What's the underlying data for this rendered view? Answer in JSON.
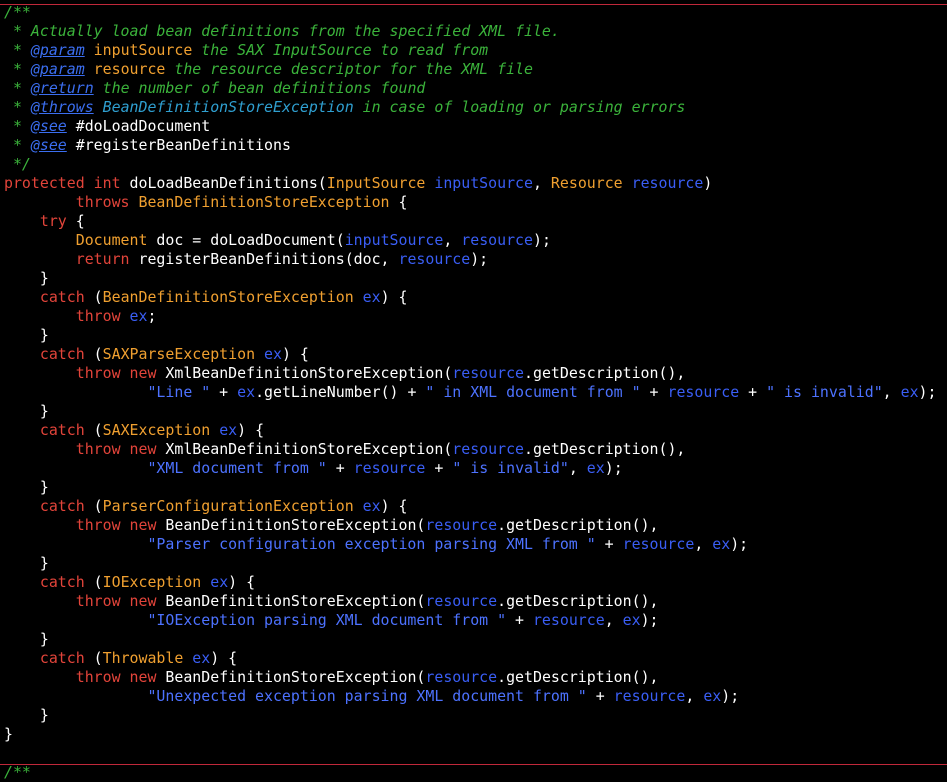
{
  "editor": {
    "language": "java",
    "colors": {
      "background": "#000000",
      "comment": "#3bb33b",
      "doc_tag": "#3b6ef0",
      "keyword": "#e2443a",
      "type": "#f0a030",
      "parameter": "#3a5ef5",
      "string": "#4d72ff",
      "plain": "#ffffff",
      "divider": "#c0283a"
    },
    "lines": [
      [
        {
          "c": "cm",
          "t": "/**"
        }
      ],
      [
        {
          "c": "cm",
          "t": " * Actually load bean definitions from the specified XML file."
        }
      ],
      [
        {
          "c": "cm",
          "t": " * "
        },
        {
          "c": "tag",
          "t": "@param"
        },
        {
          "c": "cm",
          "t": " "
        },
        {
          "c": "ty",
          "t": "inputSource"
        },
        {
          "c": "cm",
          "t": " the SAX InputSource to read from"
        }
      ],
      [
        {
          "c": "cm",
          "t": " * "
        },
        {
          "c": "tag",
          "t": "@param"
        },
        {
          "c": "cm",
          "t": " "
        },
        {
          "c": "ty",
          "t": "resource"
        },
        {
          "c": "cm",
          "t": " the resource descriptor for the XML file"
        }
      ],
      [
        {
          "c": "cm",
          "t": " * "
        },
        {
          "c": "tag",
          "t": "@return"
        },
        {
          "c": "cm",
          "t": " the number of bean definitions found"
        }
      ],
      [
        {
          "c": "cm",
          "t": " * "
        },
        {
          "c": "tag",
          "t": "@throws"
        },
        {
          "c": "cm",
          "t": " "
        },
        {
          "c": "tagx",
          "t": "BeanDefinitionStoreException"
        },
        {
          "c": "cm",
          "t": " in case of loading or parsing errors"
        }
      ],
      [
        {
          "c": "cm",
          "t": " * "
        },
        {
          "c": "tag",
          "t": "@see"
        },
        {
          "c": "cm",
          "t": " "
        },
        {
          "c": "pl",
          "t": "#doLoadDocument"
        }
      ],
      [
        {
          "c": "cm",
          "t": " * "
        },
        {
          "c": "tag",
          "t": "@see"
        },
        {
          "c": "cm",
          "t": " "
        },
        {
          "c": "pl",
          "t": "#registerBeanDefinitions"
        }
      ],
      [
        {
          "c": "cm",
          "t": " */"
        }
      ],
      [
        {
          "c": "kw",
          "t": "protected"
        },
        {
          "c": "pl",
          "t": " "
        },
        {
          "c": "kw",
          "t": "int"
        },
        {
          "c": "pl",
          "t": " doLoadBeanDefinitions("
        },
        {
          "c": "ty",
          "t": "InputSource"
        },
        {
          "c": "pl",
          "t": " "
        },
        {
          "c": "pv",
          "t": "inputSource"
        },
        {
          "c": "pl",
          "t": ", "
        },
        {
          "c": "ty",
          "t": "Resource"
        },
        {
          "c": "pl",
          "t": " "
        },
        {
          "c": "pv",
          "t": "resource"
        },
        {
          "c": "pl",
          "t": ")"
        }
      ],
      [
        {
          "c": "pl",
          "t": "        "
        },
        {
          "c": "kw",
          "t": "throws"
        },
        {
          "c": "pl",
          "t": " "
        },
        {
          "c": "ty",
          "t": "BeanDefinitionStoreException"
        },
        {
          "c": "pl",
          "t": " {"
        }
      ],
      [
        {
          "c": "pl",
          "t": "    "
        },
        {
          "c": "kw",
          "t": "try"
        },
        {
          "c": "pl",
          "t": " {"
        }
      ],
      [
        {
          "c": "pl",
          "t": "        "
        },
        {
          "c": "ty",
          "t": "Document"
        },
        {
          "c": "pl",
          "t": " doc = doLoadDocument("
        },
        {
          "c": "pv",
          "t": "inputSource"
        },
        {
          "c": "pl",
          "t": ", "
        },
        {
          "c": "pv",
          "t": "resource"
        },
        {
          "c": "pl",
          "t": ");"
        }
      ],
      [
        {
          "c": "pl",
          "t": "        "
        },
        {
          "c": "kw",
          "t": "return"
        },
        {
          "c": "pl",
          "t": " registerBeanDefinitions(doc, "
        },
        {
          "c": "pv",
          "t": "resource"
        },
        {
          "c": "pl",
          "t": ");"
        }
      ],
      [
        {
          "c": "pl",
          "t": "    }"
        }
      ],
      [
        {
          "c": "pl",
          "t": "    "
        },
        {
          "c": "kw",
          "t": "catch"
        },
        {
          "c": "pl",
          "t": " ("
        },
        {
          "c": "ty",
          "t": "BeanDefinitionStoreException"
        },
        {
          "c": "pl",
          "t": " "
        },
        {
          "c": "pv",
          "t": "ex"
        },
        {
          "c": "pl",
          "t": ") {"
        }
      ],
      [
        {
          "c": "pl",
          "t": "        "
        },
        {
          "c": "kw",
          "t": "throw"
        },
        {
          "c": "pl",
          "t": " "
        },
        {
          "c": "pv",
          "t": "ex"
        },
        {
          "c": "pl",
          "t": ";"
        }
      ],
      [
        {
          "c": "pl",
          "t": "    }"
        }
      ],
      [
        {
          "c": "pl",
          "t": "    "
        },
        {
          "c": "kw",
          "t": "catch"
        },
        {
          "c": "pl",
          "t": " ("
        },
        {
          "c": "ty",
          "t": "SAXParseException"
        },
        {
          "c": "pl",
          "t": " "
        },
        {
          "c": "pv",
          "t": "ex"
        },
        {
          "c": "pl",
          "t": ") {"
        }
      ],
      [
        {
          "c": "pl",
          "t": "        "
        },
        {
          "c": "kw",
          "t": "throw"
        },
        {
          "c": "pl",
          "t": " "
        },
        {
          "c": "kw",
          "t": "new"
        },
        {
          "c": "pl",
          "t": " XmlBeanDefinitionStoreException("
        },
        {
          "c": "pv",
          "t": "resource"
        },
        {
          "c": "pl",
          "t": ".getDescription(),"
        }
      ],
      [
        {
          "c": "pl",
          "t": "                "
        },
        {
          "c": "st",
          "t": "\"Line \""
        },
        {
          "c": "pl",
          "t": " + "
        },
        {
          "c": "pv",
          "t": "ex"
        },
        {
          "c": "pl",
          "t": ".getLineNumber() + "
        },
        {
          "c": "st",
          "t": "\" in XML document from \""
        },
        {
          "c": "pl",
          "t": " + "
        },
        {
          "c": "pv",
          "t": "resource"
        },
        {
          "c": "pl",
          "t": " + "
        },
        {
          "c": "st",
          "t": "\" is invalid\""
        },
        {
          "c": "pl",
          "t": ", "
        },
        {
          "c": "pv",
          "t": "ex"
        },
        {
          "c": "pl",
          "t": ");"
        }
      ],
      [
        {
          "c": "pl",
          "t": "    }"
        }
      ],
      [
        {
          "c": "pl",
          "t": "    "
        },
        {
          "c": "kw",
          "t": "catch"
        },
        {
          "c": "pl",
          "t": " ("
        },
        {
          "c": "ty",
          "t": "SAXException"
        },
        {
          "c": "pl",
          "t": " "
        },
        {
          "c": "pv",
          "t": "ex"
        },
        {
          "c": "pl",
          "t": ") {"
        }
      ],
      [
        {
          "c": "pl",
          "t": "        "
        },
        {
          "c": "kw",
          "t": "throw"
        },
        {
          "c": "pl",
          "t": " "
        },
        {
          "c": "kw",
          "t": "new"
        },
        {
          "c": "pl",
          "t": " XmlBeanDefinitionStoreException("
        },
        {
          "c": "pv",
          "t": "resource"
        },
        {
          "c": "pl",
          "t": ".getDescription(),"
        }
      ],
      [
        {
          "c": "pl",
          "t": "                "
        },
        {
          "c": "st",
          "t": "\"XML document from \""
        },
        {
          "c": "pl",
          "t": " + "
        },
        {
          "c": "pv",
          "t": "resource"
        },
        {
          "c": "pl",
          "t": " + "
        },
        {
          "c": "st",
          "t": "\" is invalid\""
        },
        {
          "c": "pl",
          "t": ", "
        },
        {
          "c": "pv",
          "t": "ex"
        },
        {
          "c": "pl",
          "t": ");"
        }
      ],
      [
        {
          "c": "pl",
          "t": "    }"
        }
      ],
      [
        {
          "c": "pl",
          "t": "    "
        },
        {
          "c": "kw",
          "t": "catch"
        },
        {
          "c": "pl",
          "t": " ("
        },
        {
          "c": "ty",
          "t": "ParserConfigurationException"
        },
        {
          "c": "pl",
          "t": " "
        },
        {
          "c": "pv",
          "t": "ex"
        },
        {
          "c": "pl",
          "t": ") {"
        }
      ],
      [
        {
          "c": "pl",
          "t": "        "
        },
        {
          "c": "kw",
          "t": "throw"
        },
        {
          "c": "pl",
          "t": " "
        },
        {
          "c": "kw",
          "t": "new"
        },
        {
          "c": "pl",
          "t": " BeanDefinitionStoreException("
        },
        {
          "c": "pv",
          "t": "resource"
        },
        {
          "c": "pl",
          "t": ".getDescription(),"
        }
      ],
      [
        {
          "c": "pl",
          "t": "                "
        },
        {
          "c": "st",
          "t": "\"Parser configuration exception parsing XML from \""
        },
        {
          "c": "pl",
          "t": " + "
        },
        {
          "c": "pv",
          "t": "resource"
        },
        {
          "c": "pl",
          "t": ", "
        },
        {
          "c": "pv",
          "t": "ex"
        },
        {
          "c": "pl",
          "t": ");"
        }
      ],
      [
        {
          "c": "pl",
          "t": "    }"
        }
      ],
      [
        {
          "c": "pl",
          "t": "    "
        },
        {
          "c": "kw",
          "t": "catch"
        },
        {
          "c": "pl",
          "t": " ("
        },
        {
          "c": "ty",
          "t": "IOException"
        },
        {
          "c": "pl",
          "t": " "
        },
        {
          "c": "pv",
          "t": "ex"
        },
        {
          "c": "pl",
          "t": ") {"
        }
      ],
      [
        {
          "c": "pl",
          "t": "        "
        },
        {
          "c": "kw",
          "t": "throw"
        },
        {
          "c": "pl",
          "t": " "
        },
        {
          "c": "kw",
          "t": "new"
        },
        {
          "c": "pl",
          "t": " BeanDefinitionStoreException("
        },
        {
          "c": "pv",
          "t": "resource"
        },
        {
          "c": "pl",
          "t": ".getDescription(),"
        }
      ],
      [
        {
          "c": "pl",
          "t": "                "
        },
        {
          "c": "st",
          "t": "\"IOException parsing XML document from \""
        },
        {
          "c": "pl",
          "t": " + "
        },
        {
          "c": "pv",
          "t": "resource"
        },
        {
          "c": "pl",
          "t": ", "
        },
        {
          "c": "pv",
          "t": "ex"
        },
        {
          "c": "pl",
          "t": ");"
        }
      ],
      [
        {
          "c": "pl",
          "t": "    }"
        }
      ],
      [
        {
          "c": "pl",
          "t": "    "
        },
        {
          "c": "kw",
          "t": "catch"
        },
        {
          "c": "pl",
          "t": " ("
        },
        {
          "c": "ty",
          "t": "Throwable"
        },
        {
          "c": "pl",
          "t": " "
        },
        {
          "c": "pv",
          "t": "ex"
        },
        {
          "c": "pl",
          "t": ") {"
        }
      ],
      [
        {
          "c": "pl",
          "t": "        "
        },
        {
          "c": "kw",
          "t": "throw"
        },
        {
          "c": "pl",
          "t": " "
        },
        {
          "c": "kw",
          "t": "new"
        },
        {
          "c": "pl",
          "t": " BeanDefinitionStoreException("
        },
        {
          "c": "pv",
          "t": "resource"
        },
        {
          "c": "pl",
          "t": ".getDescription(),"
        }
      ],
      [
        {
          "c": "pl",
          "t": "                "
        },
        {
          "c": "st",
          "t": "\"Unexpected exception parsing XML document from \""
        },
        {
          "c": "pl",
          "t": " + "
        },
        {
          "c": "pv",
          "t": "resource"
        },
        {
          "c": "pl",
          "t": ", "
        },
        {
          "c": "pv",
          "t": "ex"
        },
        {
          "c": "pl",
          "t": ");"
        }
      ],
      [
        {
          "c": "pl",
          "t": "    }"
        }
      ],
      [
        {
          "c": "pl",
          "t": "}"
        }
      ],
      [
        {
          "c": "pl",
          "t": ""
        }
      ],
      [
        {
          "c": "cm",
          "t": "/**"
        }
      ]
    ]
  }
}
